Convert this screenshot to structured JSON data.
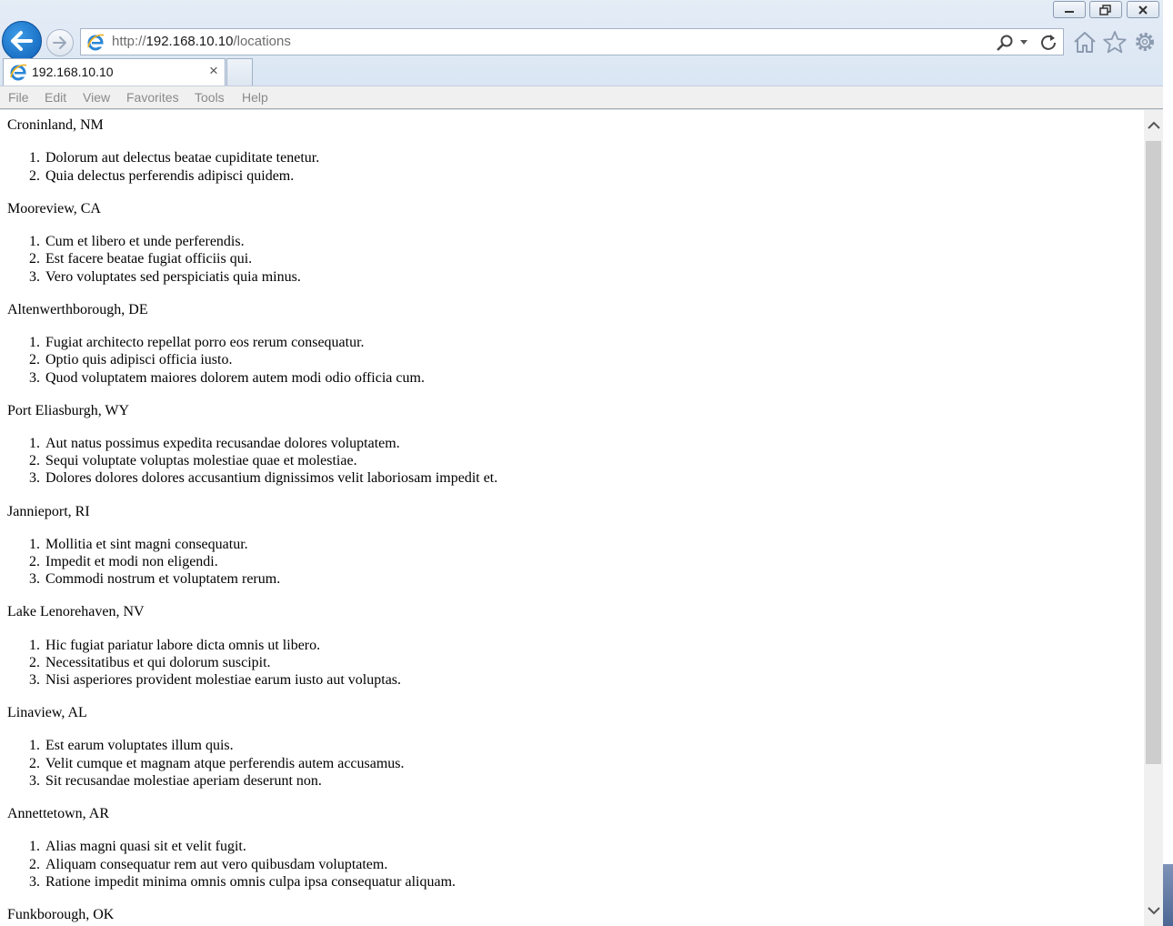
{
  "browser": {
    "url_prefix": "http://",
    "url_host": "192.168.10.10",
    "url_path": "/locations",
    "tab_title": "192.168.10.10",
    "tab_close": "×",
    "menu": [
      "File",
      "Edit",
      "View",
      "Favorites",
      "Tools",
      "Help"
    ]
  },
  "locations": [
    {
      "name": "Croninland, NM",
      "items": [
        "Dolorum aut delectus beatae cupiditate tenetur.",
        "Quia delectus perferendis adipisci quidem."
      ]
    },
    {
      "name": "Mooreview, CA",
      "items": [
        "Cum et libero et unde perferendis.",
        "Est facere beatae fugiat officiis qui.",
        "Vero voluptates sed perspiciatis quia minus."
      ]
    },
    {
      "name": "Altenwerthborough, DE",
      "items": [
        "Fugiat architecto repellat porro eos rerum consequatur.",
        "Optio quis adipisci officia iusto.",
        "Quod voluptatem maiores dolorem autem modi odio officia cum."
      ]
    },
    {
      "name": "Port Eliasburgh, WY",
      "items": [
        "Aut natus possimus expedita recusandae dolores voluptatem.",
        "Sequi voluptate voluptas molestiae quae et molestiae.",
        "Dolores dolores dolores accusantium dignissimos velit laboriosam impedit et."
      ]
    },
    {
      "name": "Jannieport, RI",
      "items": [
        "Mollitia et sint magni consequatur.",
        "Impedit et modi non eligendi.",
        "Commodi nostrum et voluptatem rerum."
      ]
    },
    {
      "name": "Lake Lenorehaven, NV",
      "items": [
        "Hic fugiat pariatur labore dicta omnis ut libero.",
        "Necessitatibus et qui dolorum suscipit.",
        "Nisi asperiores provident molestiae earum iusto aut voluptas."
      ]
    },
    {
      "name": "Linaview, AL",
      "items": [
        "Est earum voluptates illum quis.",
        "Velit cumque et magnam atque perferendis autem accusamus.",
        "Sit recusandae molestiae aperiam deserunt non."
      ]
    },
    {
      "name": "Annettetown, AR",
      "items": [
        "Alias magni quasi sit et velit fugit.",
        "Aliquam consequatur rem aut vero quibusdam voluptatem.",
        "Ratione impedit minima omnis omnis culpa ipsa consequatur aliquam."
      ]
    },
    {
      "name": "Funkborough, OK",
      "items": []
    }
  ]
}
